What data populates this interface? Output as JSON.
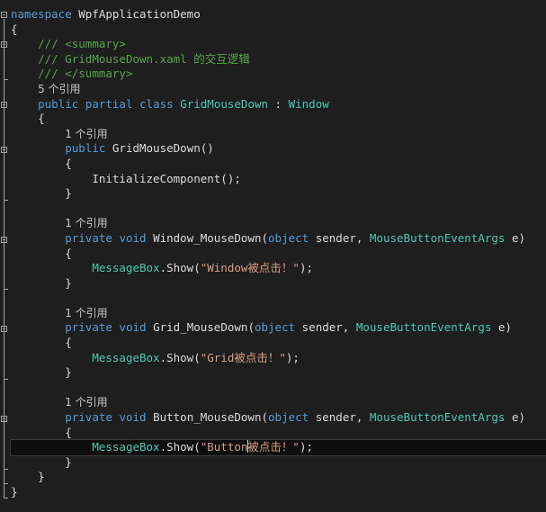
{
  "colors": {
    "background": "#1e1e1e",
    "keyword": "#569cd6",
    "comment": "#57a64a",
    "type": "#4ec9b0",
    "string": "#d69d85",
    "text": "#dcdcdc"
  },
  "code": {
    "namespace_kw": "namespace",
    "namespace_name": " WpfApplicationDemo",
    "brace_open": "{",
    "brace_close": "}",
    "comment_summary_open": "/// <summary>",
    "comment_desc": "/// GridMouseDown.xaml 的交互逻辑",
    "comment_summary_close": "/// </summary>",
    "class_refs": "5 个引用",
    "kw_public": "public",
    "kw_partial": "partial",
    "kw_class": "class",
    "class_name": "GridMouseDown",
    "colon": " : ",
    "base_class": "Window",
    "ctor_refs": "1 个引用",
    "ctor_name": "GridMouseDown",
    "ctor_parens": "()",
    "init_call": "InitializeComponent();",
    "kw_private": "private",
    "kw_void": "void",
    "kw_object": "object",
    "args_type": "MouseButtonEventArgs",
    "sender": " sender, ",
    "param_e": " e)",
    "msgbox": "MessageBox",
    "show": ".Show(",
    "close_call": ");",
    "methods": [
      {
        "refs": "1 个引用",
        "name": "Window_MouseDown",
        "msg": "\"Window被点击！\""
      },
      {
        "refs": "1 个引用",
        "name": "Grid_MouseDown",
        "msg": "\"Grid被点击！\""
      },
      {
        "refs": "1 个引用",
        "name": "Button_MouseDown",
        "msg_a": "\"Button",
        "msg_b": "被点击！\""
      }
    ]
  }
}
